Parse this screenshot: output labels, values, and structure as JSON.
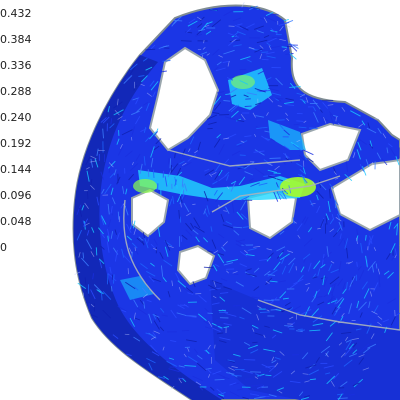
{
  "legend": {
    "labels": [
      "0.432",
      "0.384",
      "0.336",
      "0.288",
      "0.240",
      "0.192",
      "0.144",
      "0.096",
      "0.048",
      "0"
    ]
  },
  "colors": {
    "background": "#ffffff",
    "vector_low": "#1a2fe0",
    "vector_mid": "#19c6ff",
    "vector_high": "#c8ff1e",
    "outline": "#9aa6ad"
  }
}
